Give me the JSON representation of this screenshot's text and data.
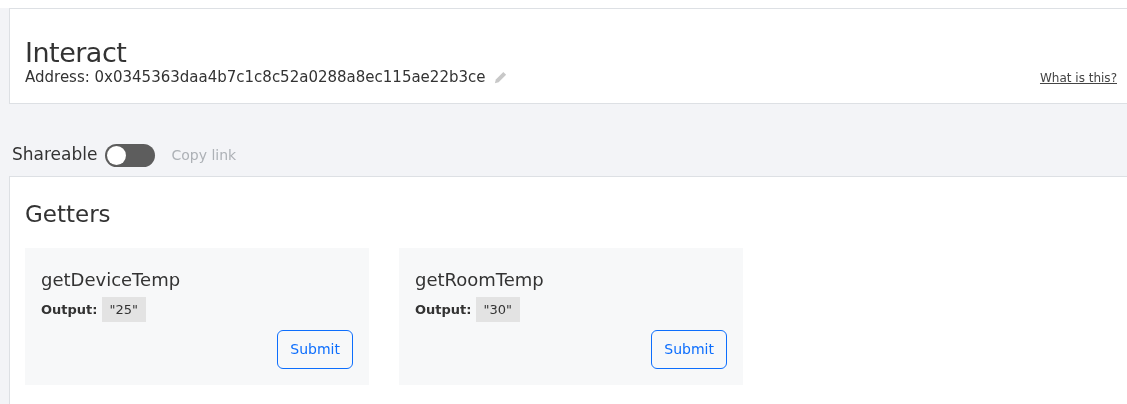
{
  "header": {
    "title": "Interact",
    "address_label": "Address:",
    "address": "0x0345363daa4b7c1c8c52a0288a8ec115ae22b3ce",
    "help_link": "What is this?"
  },
  "share": {
    "label": "Shareable",
    "on": false,
    "copy_link": "Copy link"
  },
  "getters": {
    "title": "Getters",
    "items": [
      {
        "name": "getDeviceTemp",
        "output_label": "Output:",
        "output": "\"25\"",
        "button": "Submit"
      },
      {
        "name": "getRoomTemp",
        "output_label": "Output:",
        "output": "\"30\"",
        "button": "Submit"
      }
    ]
  }
}
